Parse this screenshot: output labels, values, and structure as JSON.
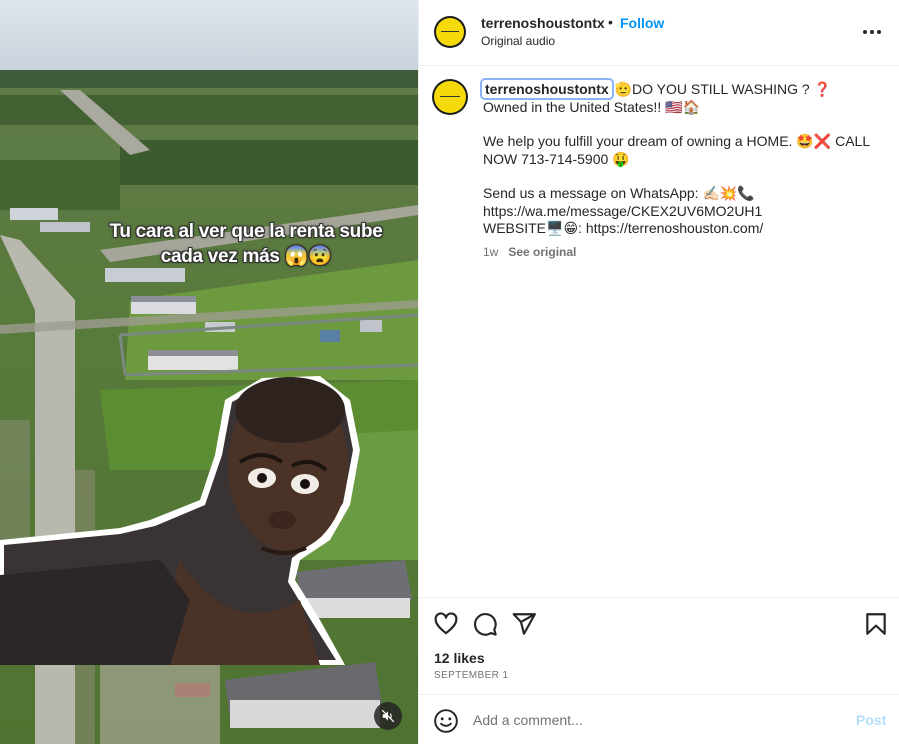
{
  "post": {
    "username": "terrenoshoustontx",
    "separator": "•",
    "follow_label": "Follow",
    "audio_label": "Original audio",
    "video_overlay_text": "Tu cara al ver que la renta sube cada vez más 😱😨",
    "caption": {
      "line1_rest": "🫡DO YOU STILL WASHING ? ❓ Owned in the United States!! 🇺🇸🏠",
      "paragraph2": "We help you fulfill your dream of owning a HOME. 🤩❌ CALL NOW 713-714-5900 🤑",
      "paragraph3_line1": "Send us a message on WhatsApp: ✍🏻💥📞",
      "paragraph3_line2": "https://wa.me/message/CKEX2UV6MO2UH1",
      "paragraph3_line3": "WEBSITE🖥️😁: https://terrenoshouston.com/"
    },
    "time_ago": "1w",
    "see_original_label": "See original",
    "likes": "12 likes",
    "date": "SEPTEMBER 1",
    "comment_placeholder": "Add a comment...",
    "post_label": "Post"
  },
  "icons": {
    "more": "more-options-icon",
    "like": "heart-icon",
    "comment": "comment-icon",
    "share": "send-icon",
    "save": "bookmark-icon",
    "emoji": "emoji-smile-icon",
    "mute": "muted-speaker-icon"
  },
  "colors": {
    "accent_link": "#0095f6",
    "post_disabled": "#b2dffc",
    "avatar_yellow": "#f5d90a"
  }
}
